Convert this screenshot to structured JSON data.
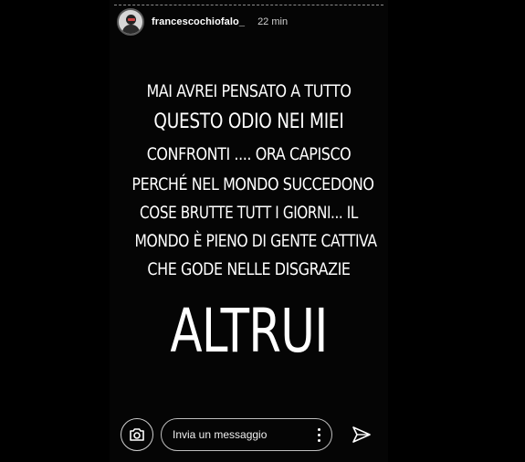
{
  "header": {
    "username": "francescochiofalo_",
    "time": "22 min"
  },
  "story": {
    "lines": [
      "MAI AVREI PENSATO A TUTTO",
      "QUESTO ODIO NEI MIEI",
      "CONFRONTI .... ORA CAPISCO",
      "PERCHÉ NEL MONDO SUCCEDONO",
      "COSE BRUTTE TUTT I GIORNI... IL",
      "MONDO È PIENO DI GENTE CATTIVA",
      "CHE GODE NELLE DISGRAZIE"
    ],
    "big": "ALTRUI"
  },
  "footer": {
    "message_placeholder": "Invia un messaggio"
  },
  "icons": [
    "camera-icon",
    "more-icon",
    "send-icon"
  ]
}
